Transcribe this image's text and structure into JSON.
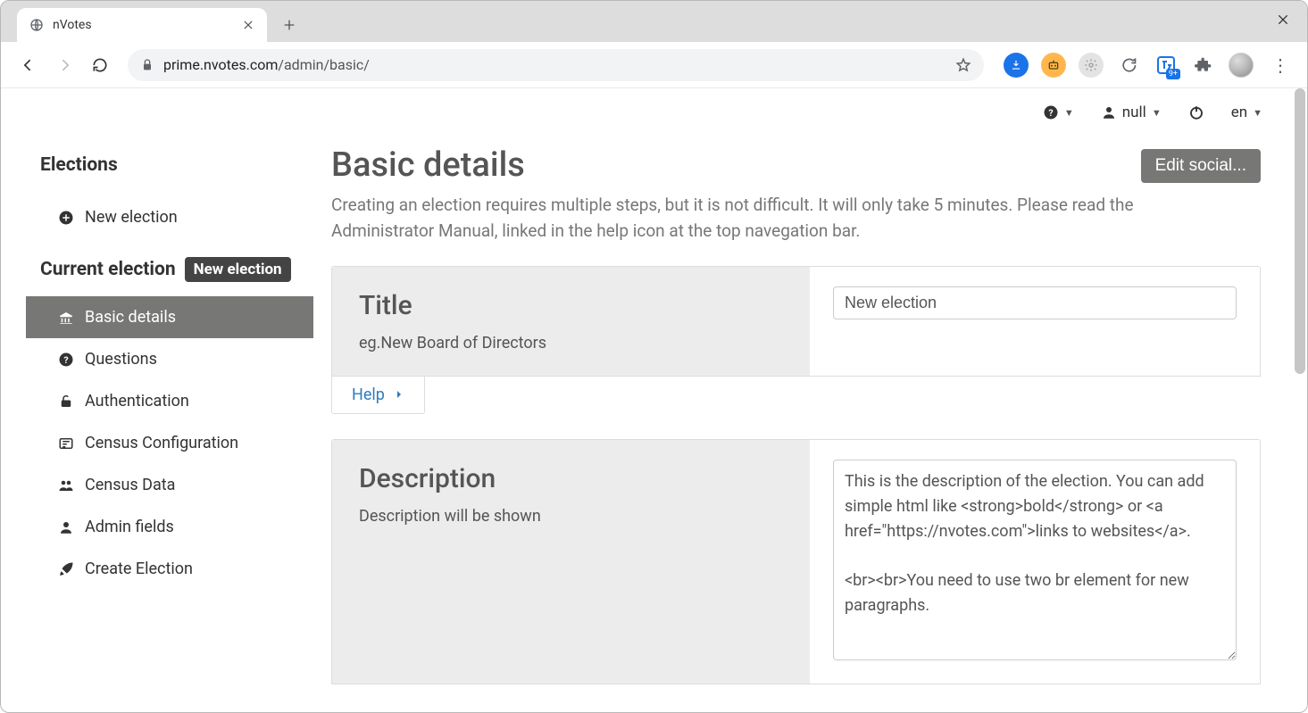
{
  "browser": {
    "tab_title": "nVotes",
    "url_host": "prime.nvotes.com",
    "url_path": "/admin/basic/",
    "translate_badge": "9+"
  },
  "topbar": {
    "user_label": "null",
    "lang_label": "en"
  },
  "sidebar": {
    "h_elections": "Elections",
    "new_election": "New election",
    "h_current": "Current election",
    "current_badge": "New election",
    "items": [
      {
        "label": "Basic details"
      },
      {
        "label": "Questions"
      },
      {
        "label": "Authentication"
      },
      {
        "label": "Census Configuration"
      },
      {
        "label": "Census Data"
      },
      {
        "label": "Admin fields"
      },
      {
        "label": "Create Election"
      }
    ]
  },
  "content": {
    "title": "Basic details",
    "lead": "Creating an election requires multiple steps, but it is not difficult. It will only take 5 minutes. Please read the Administrator Manual, linked in the help icon at the top navegation bar.",
    "edit_button": "Edit social...",
    "fields": {
      "title": {
        "heading": "Title",
        "hint": "eg.New Board of Directors",
        "value": "New election",
        "help": "Help"
      },
      "description": {
        "heading": "Description",
        "hint": "Description will be shown",
        "value": "This is the description of the election. You can add simple html like <strong>bold</strong> or <a href=\"https://nvotes.com\">links to websites</a>.\n\n<br><br>You need to use two br element for new paragraphs."
      }
    }
  }
}
